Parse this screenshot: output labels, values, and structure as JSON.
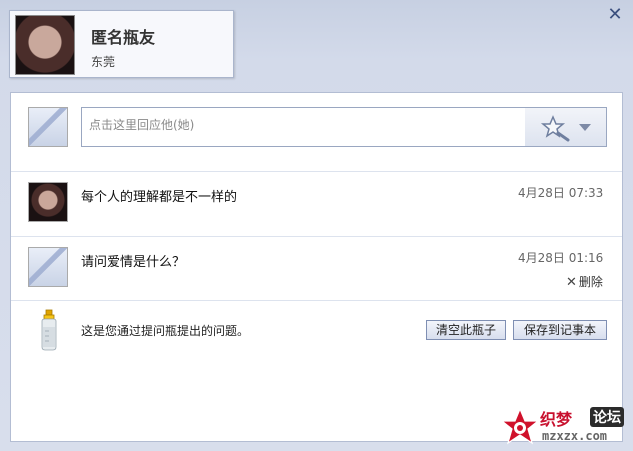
{
  "header": {
    "name": "匿名瓶友",
    "location": "东莞"
  },
  "reply": {
    "placeholder": "点击这里回应他(她)"
  },
  "messages": [
    {
      "text": "每个人的理解都是不一样的",
      "time": "4月28日 07:33"
    },
    {
      "text": "请问爱情是什么？",
      "time": "4月28日 01:16",
      "delete_label": "删除"
    }
  ],
  "footer": {
    "info": "这是您通过提问瓶提出的问题。",
    "clear_button": "清空此瓶子",
    "save_button": "保存到记事本"
  },
  "watermark": {
    "text": "织梦",
    "forum": "论坛",
    "url": "mzxzx.com"
  },
  "colors": {
    "accent": "#3b4f7e",
    "background": "#d3daea"
  },
  "icons": [
    "close-icon",
    "magic-wand-icon",
    "dropdown-arrow-icon",
    "bottle-icon",
    "delete-icon"
  ]
}
